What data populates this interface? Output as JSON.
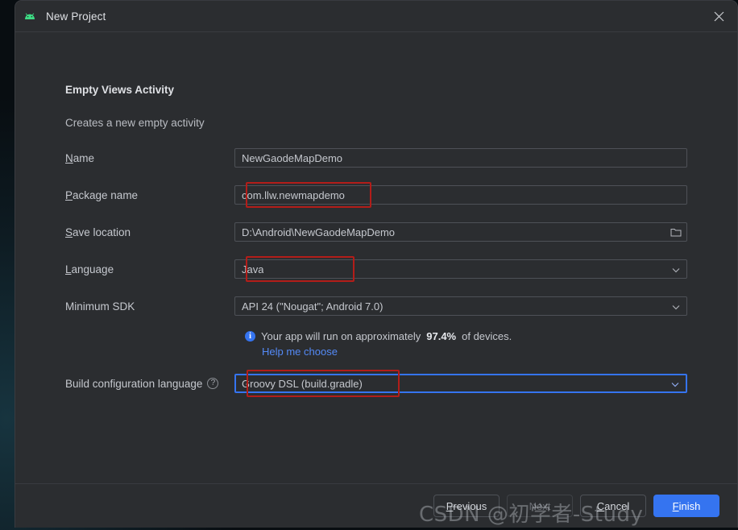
{
  "window": {
    "title": "New Project",
    "app_icon": "android-icon",
    "close_icon": "close-icon"
  },
  "template": {
    "heading": "Empty Views Activity",
    "description": "Creates a new empty activity"
  },
  "form": {
    "name": {
      "label": "Name",
      "mnemonic": "N",
      "rest": "ame",
      "value": "NewGaodeMapDemo",
      "type": "text"
    },
    "package_name": {
      "label": "Package name",
      "mnemonic": "P",
      "rest": "ackage name",
      "value": "com.llw.newmapdemo",
      "type": "text",
      "annotated": true
    },
    "save_location": {
      "label": "Save location",
      "mnemonic": "S",
      "rest": "ave location",
      "value": "D:\\Android\\NewGaodeMapDemo",
      "type": "text",
      "trailing_icon": "folder-icon"
    },
    "language": {
      "label": "Language",
      "mnemonic": "L",
      "rest": "anguage",
      "value": "Java",
      "type": "combo",
      "annotated": true
    },
    "minimum_sdk": {
      "label": "Minimum SDK",
      "value": "API 24 (\"Nougat\"; Android 7.0)",
      "type": "combo"
    },
    "build_config": {
      "label": "Build configuration language",
      "help_icon": "question-mark-icon",
      "value": "Groovy DSL (build.gradle)",
      "type": "combo",
      "focused": true,
      "annotated": true
    }
  },
  "info": {
    "icon": "info-icon",
    "text_before": "Your app will run on approximately",
    "percent": "97.4%",
    "text_after": "of devices.",
    "link": "Help me choose"
  },
  "footer": {
    "previous": {
      "mnemonic": "P",
      "rest": "revious",
      "label": "Previous",
      "enabled": true
    },
    "next": {
      "label": "Next",
      "enabled": false
    },
    "cancel": {
      "mnemonic": "C",
      "rest": "ancel",
      "label": "Cancel",
      "enabled": true
    },
    "finish": {
      "mnemonic": "F",
      "rest": "inish",
      "label": "Finish",
      "enabled": true,
      "primary": true
    }
  },
  "watermark": "CSDN @初学者-Study",
  "colors": {
    "dialog_bg": "#2b2d30",
    "accent_blue": "#3574f0",
    "link_blue": "#548af7",
    "annotation_red": "#b31d19",
    "android_green": "#3ddc84",
    "text_primary": "#dfe1e5",
    "text_secondary": "#c5c8ce"
  }
}
